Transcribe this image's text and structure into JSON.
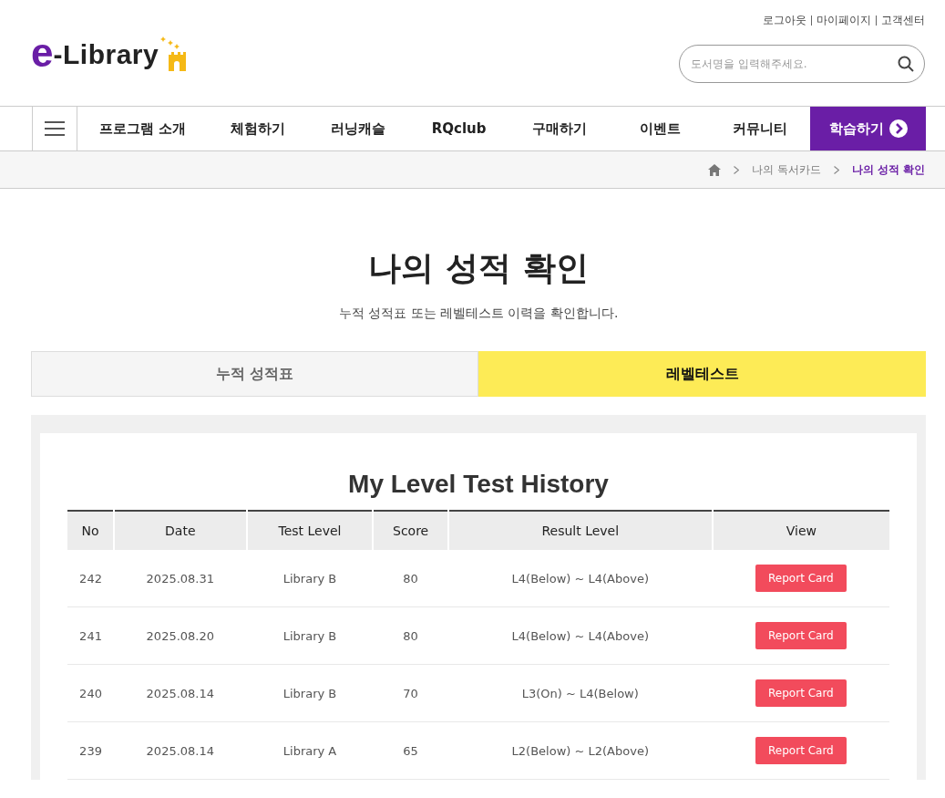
{
  "header": {
    "logo": {
      "mark": "e",
      "text": "-Library"
    },
    "top_links": [
      "로그아웃",
      "마이페이지",
      "고객센터"
    ],
    "search": {
      "placeholder": "도서명을 입력해주세요."
    }
  },
  "nav": {
    "items": [
      {
        "label": "프로그램 소개",
        "selected": false
      },
      {
        "label": "체험하기",
        "selected": false
      },
      {
        "label": "러닝캐슬",
        "selected": false
      },
      {
        "label": "RQclub",
        "selected": false
      },
      {
        "label": "구매하기",
        "selected": false
      },
      {
        "label": "이벤트",
        "selected": false
      },
      {
        "label": "커뮤니티",
        "selected": false
      },
      {
        "label": "학습하기",
        "selected": true
      }
    ]
  },
  "breadcrumb": {
    "items": [
      "나의 독서카드",
      "나의 성적 확인"
    ]
  },
  "page": {
    "title": "나의 성적 확인",
    "subtitle": "누적 성적표 또는 레벨테스트 이력을 확인합니다."
  },
  "tabs": [
    {
      "label": "누적 성적표",
      "selected": false
    },
    {
      "label": "레벨테스트",
      "selected": true
    }
  ],
  "table": {
    "title": "My Level Test History",
    "columns": [
      "No",
      "Date",
      "Test Level",
      "Score",
      "Result Level",
      "View"
    ],
    "rows": [
      {
        "no": "242",
        "date": "2025.08.31",
        "test_level": "Library B",
        "score": "80",
        "result_level": "L4(Below) ~ L4(Above)",
        "action": "Report Card"
      },
      {
        "no": "241",
        "date": "2025.08.20",
        "test_level": "Library B",
        "score": "80",
        "result_level": "L4(Below) ~ L4(Above)",
        "action": "Report Card"
      },
      {
        "no": "240",
        "date": "2025.08.14",
        "test_level": "Library B",
        "score": "70",
        "result_level": "L3(On) ~ L4(Below)",
        "action": "Report Card"
      },
      {
        "no": "239",
        "date": "2025.08.14",
        "test_level": "Library A",
        "score": "65",
        "result_level": "L2(Below) ~ L2(Above)",
        "action": "Report Card"
      }
    ]
  }
}
